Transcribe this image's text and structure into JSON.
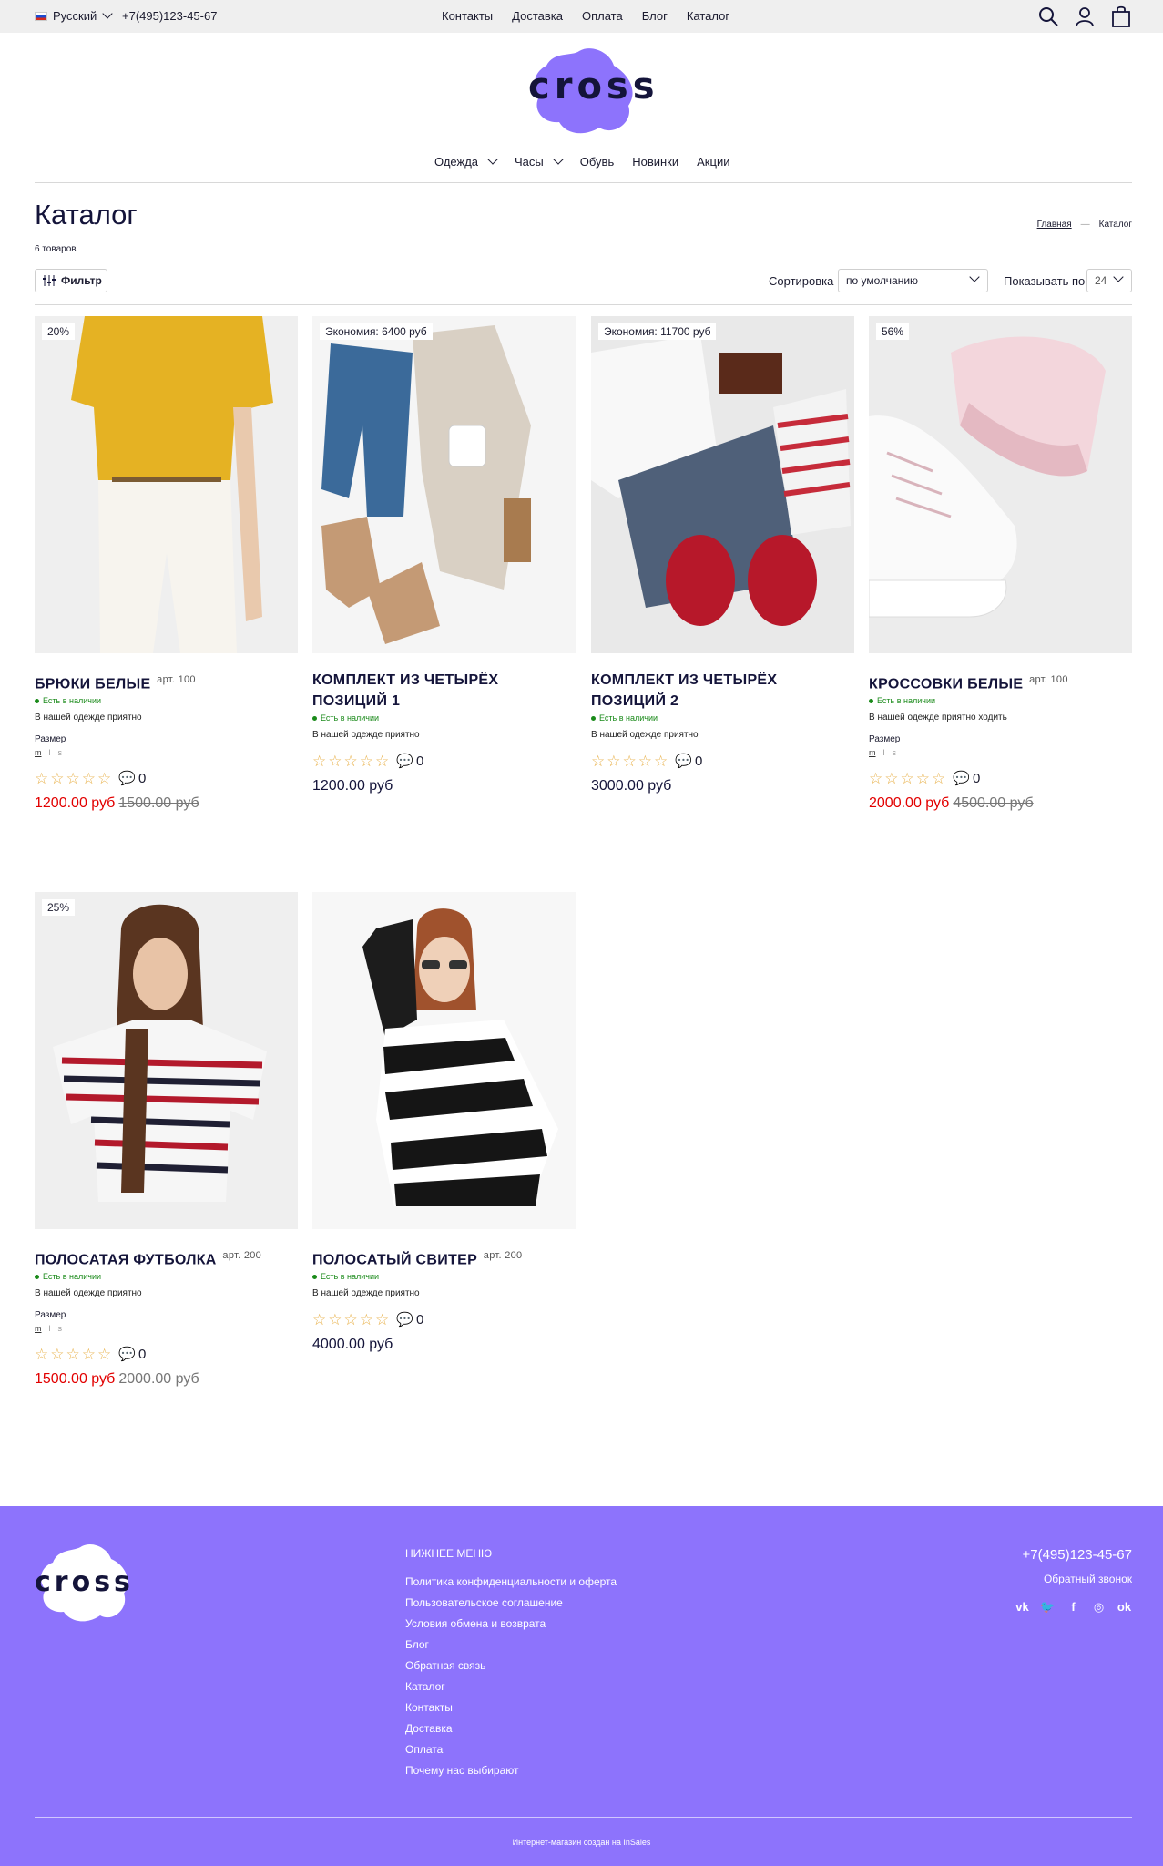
{
  "topbar": {
    "language": "Русский",
    "phone": "+7(495)123-45-67",
    "nav": [
      "Контакты",
      "Доставка",
      "Оплата",
      "Блог",
      "Каталог"
    ]
  },
  "header": {
    "logo": "cross",
    "nav": [
      "Одежда",
      "Часы",
      "Обувь",
      "Новинки",
      "Акции"
    ]
  },
  "catalog": {
    "title": "Каталог",
    "count": "6 товаров",
    "breadcrumb": {
      "home": "Главная",
      "separator": "—",
      "current": "Каталог"
    },
    "filter_label": "Фильтр",
    "sort_label": "Сортировка",
    "sort_value": "по умолчанию",
    "per_page_label": "Показывать по",
    "per_page_value": "24"
  },
  "products": [
    {
      "badge": "20%",
      "name": "БРЮКИ БЕЛЫЕ",
      "art": "арт. 100",
      "stock": "Есть в наличии",
      "desc": "В нашей одежде приятно",
      "size_label": "Размер",
      "sizes": [
        "m",
        "l",
        "s"
      ],
      "comments": "0",
      "price": "1200.00 руб",
      "old_price": "1500.00 руб"
    },
    {
      "badge": "Экономия: 6400 руб",
      "name": "КОМПЛЕКТ ИЗ ЧЕТЫРЁХ ПОЗИЦИЙ 1",
      "stock": "Есть в наличии",
      "desc": "В нашей одежде приятно",
      "comments": "0",
      "price": "1200.00 руб"
    },
    {
      "badge": "Экономия: 11700 руб",
      "name": "КОМПЛЕКТ ИЗ ЧЕТЫРЁХ ПОЗИЦИЙ 2",
      "stock": "Есть в наличии",
      "desc": "В нашей одежде приятно",
      "comments": "0",
      "price": "3000.00 руб"
    },
    {
      "badge": "56%",
      "name": "КРОССОВКИ БЕЛЫЕ",
      "art": "арт. 100",
      "stock": "Есть в наличии",
      "desc": "В нашей одежде приятно ходить",
      "size_label": "Размер",
      "sizes": [
        "m",
        "l",
        "s"
      ],
      "comments": "0",
      "price": "2000.00 руб",
      "old_price": "4500.00 руб"
    },
    {
      "badge": "25%",
      "name": "ПОЛОСАТАЯ ФУТБОЛКА",
      "art": "арт. 200",
      "stock": "Есть в наличии",
      "desc": "В нашей одежде приятно",
      "size_label": "Размер",
      "sizes": [
        "m",
        "l",
        "s"
      ],
      "comments": "0",
      "price": "1500.00 руб",
      "old_price": "2000.00 руб"
    },
    {
      "name": "ПОЛОСАТЫЙ СВИТЕР",
      "art": "арт. 200",
      "stock": "Есть в наличии",
      "desc": "В нашей одежде приятно",
      "comments": "0",
      "price": "4000.00 руб"
    }
  ],
  "footer": {
    "logo": "cross",
    "menu_title": "НИЖНЕЕ МЕНЮ",
    "menu": [
      "Политика конфиденциальности и оферта",
      "Пользовательское соглашение",
      "Условия обмена и возврата",
      "Блог",
      "Обратная связь",
      "Каталог",
      "Контакты",
      "Доставка",
      "Оплата",
      "Почему нас выбирают"
    ],
    "phone": "+7(495)123-45-67",
    "callback": "Обратный звонок",
    "social": [
      "vk-icon",
      "twitter-icon",
      "facebook-icon",
      "instagram-icon",
      "odnoklassniki-icon"
    ],
    "copyright": "Интернет-магазин создан на InSales"
  },
  "colors": {
    "accent": "#8d73fc",
    "sale": "#e20000",
    "stock": "#1a8a1a",
    "text": "#14143a"
  }
}
